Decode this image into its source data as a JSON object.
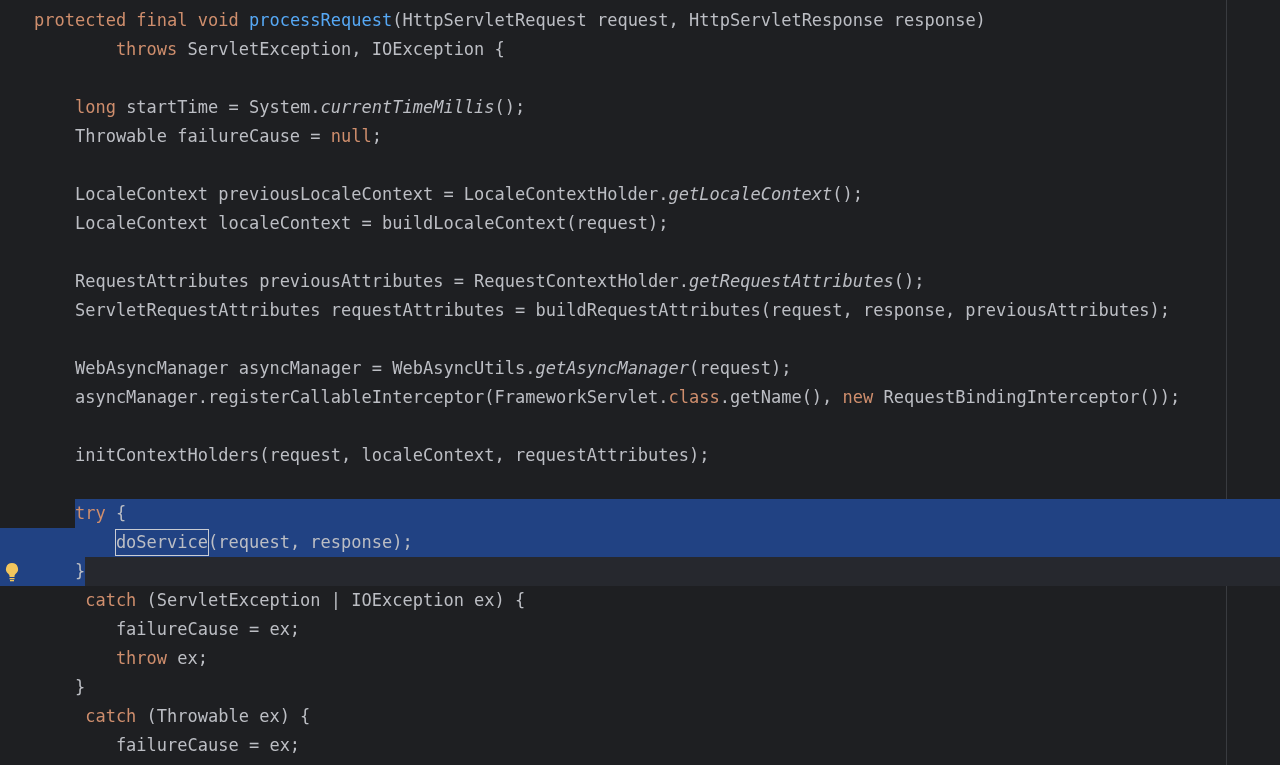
{
  "editor": {
    "blocks": [
      {
        "lines": [
          {
            "selected": false,
            "current": false,
            "tokens": [
              {
                "kind": "keyword",
                "text": "protected final void "
              },
              {
                "kind": "declaration",
                "text": "processRequest"
              },
              {
                "kind": "plain",
                "text": "(HttpServletRequest request, HttpServletResponse response)"
              }
            ]
          },
          {
            "selected": false,
            "current": false,
            "tokens": [
              {
                "kind": "keyword",
                "text": "        throws "
              },
              {
                "kind": "plain",
                "text": "ServletException, IOException {"
              }
            ]
          }
        ]
      },
      {
        "lines": [
          {
            "selected": false,
            "current": false,
            "tokens": [
              {
                "kind": "keyword",
                "text": "    long "
              },
              {
                "kind": "plain",
                "text": "startTime = System."
              },
              {
                "kind": "static",
                "text": "currentTimeMillis"
              },
              {
                "kind": "plain",
                "text": "();"
              }
            ]
          },
          {
            "selected": false,
            "current": false,
            "tokens": [
              {
                "kind": "plain",
                "text": "    Throwable failureCause = "
              },
              {
                "kind": "keyword",
                "text": "null"
              },
              {
                "kind": "plain",
                "text": ";"
              }
            ]
          }
        ]
      },
      {
        "lines": [
          {
            "selected": false,
            "current": false,
            "tokens": [
              {
                "kind": "plain",
                "text": "    LocaleContext previousLocaleContext = LocaleContextHolder."
              },
              {
                "kind": "static",
                "text": "getLocaleContext"
              },
              {
                "kind": "plain",
                "text": "();"
              }
            ]
          },
          {
            "selected": false,
            "current": false,
            "tokens": [
              {
                "kind": "plain",
                "text": "    LocaleContext localeContext = buildLocaleContext(request);"
              }
            ]
          }
        ]
      },
      {
        "lines": [
          {
            "selected": false,
            "current": false,
            "tokens": [
              {
                "kind": "plain",
                "text": "    RequestAttributes previousAttributes = RequestContextHolder."
              },
              {
                "kind": "static",
                "text": "getRequestAttributes"
              },
              {
                "kind": "plain",
                "text": "();"
              }
            ]
          },
          {
            "selected": false,
            "current": false,
            "tokens": [
              {
                "kind": "plain",
                "text": "    ServletRequestAttributes requestAttributes = buildRequestAttributes(request, response, previousAttributes);"
              }
            ]
          }
        ]
      },
      {
        "lines": [
          {
            "selected": false,
            "current": false,
            "tokens": [
              {
                "kind": "plain",
                "text": "    WebAsyncManager asyncManager = WebAsyncUtils."
              },
              {
                "kind": "static",
                "text": "getAsyncManager"
              },
              {
                "kind": "plain",
                "text": "(request);"
              }
            ]
          },
          {
            "selected": false,
            "current": false,
            "tokens": [
              {
                "kind": "plain",
                "text": "    asyncManager.registerCallableInterceptor(FrameworkServlet."
              },
              {
                "kind": "keyword",
                "text": "class"
              },
              {
                "kind": "plain",
                "text": ".getName(), "
              },
              {
                "kind": "keyword",
                "text": "new "
              },
              {
                "kind": "plain",
                "text": "RequestBindingInterceptor());"
              }
            ]
          }
        ]
      },
      {
        "lines": [
          {
            "selected": false,
            "current": false,
            "tokens": [
              {
                "kind": "plain",
                "text": "    initContextHolders(request, localeContext, requestAttributes);"
              }
            ]
          }
        ]
      },
      {
        "lines": [
          {
            "selected": true,
            "current": false,
            "tokens": [
              {
                "kind": "keyword",
                "text": "    try "
              },
              {
                "kind": "plain",
                "text": "{"
              }
            ]
          },
          {
            "selected": true,
            "current": false,
            "tokens": [
              {
                "kind": "usage",
                "text": "        doService"
              },
              {
                "kind": "plain",
                "text": "(request, response);"
              }
            ]
          },
          {
            "selected": true,
            "current": true,
            "intention_bulb": true,
            "tokens": [
              {
                "kind": "plain",
                "text": "    }"
              }
            ]
          },
          {
            "selected": false,
            "current": false,
            "tokens": [
              {
                "kind": "keyword",
                "text": "     catch "
              },
              {
                "kind": "plain",
                "text": "(ServletException | IOException ex) {"
              }
            ]
          },
          {
            "selected": false,
            "current": false,
            "tokens": [
              {
                "kind": "plain",
                "text": "        failureCause = ex;"
              }
            ]
          },
          {
            "selected": false,
            "current": false,
            "tokens": [
              {
                "kind": "keyword",
                "text": "        throw "
              },
              {
                "kind": "plain",
                "text": "ex;"
              }
            ]
          },
          {
            "selected": false,
            "current": false,
            "tokens": [
              {
                "kind": "plain",
                "text": "    }"
              }
            ]
          },
          {
            "selected": false,
            "current": false,
            "tokens": [
              {
                "kind": "keyword",
                "text": "     catch "
              },
              {
                "kind": "plain",
                "text": "(Throwable ex) {"
              }
            ]
          },
          {
            "selected": false,
            "current": false,
            "tokens": [
              {
                "kind": "plain",
                "text": "        failureCause = ex;"
              }
            ]
          }
        ]
      }
    ]
  }
}
